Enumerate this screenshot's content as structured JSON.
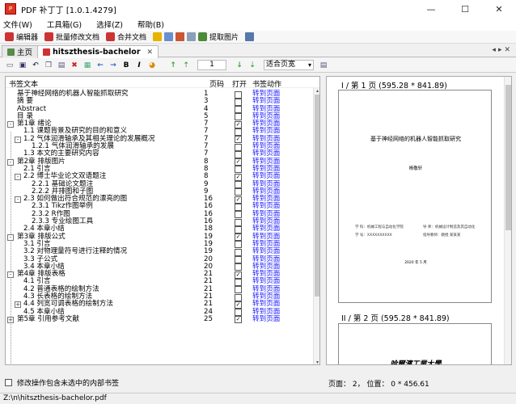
{
  "app": {
    "title": "PDF 补丁丁 [1.0.1.4279]"
  },
  "menu": [
    "文件(W)",
    "工具箱(G)",
    "选择(Z)",
    "帮助(B)"
  ],
  "toolbar1": [
    "编辑器",
    "批量修改文档",
    "合并文档",
    "提取图片"
  ],
  "tabs": {
    "home": "主页",
    "doc": "hitszthesis-bachelor"
  },
  "toolbar2": {
    "page": "1",
    "zoom": "适合页宽"
  },
  "table": {
    "headers": [
      "书签文本",
      "页码",
      "打开",
      "书签动作"
    ],
    "rows": [
      {
        "text": "基于神经网络的机器人智能抓取研究",
        "page": "1",
        "open": false,
        "action": "转到页面",
        "level": 0,
        "tog": ""
      },
      {
        "text": "摘  要",
        "page": "3",
        "open": false,
        "action": "转到页面",
        "level": 0,
        "tog": ""
      },
      {
        "text": "Abstract",
        "page": "4",
        "open": false,
        "action": "转到页面",
        "level": 0,
        "tog": ""
      },
      {
        "text": "目  录",
        "page": "5",
        "open": false,
        "action": "转到页面",
        "level": 0,
        "tog": ""
      },
      {
        "text": "第1章 绪论",
        "page": "7",
        "open": true,
        "action": "转到页面",
        "level": 0,
        "tog": "-"
      },
      {
        "text": "1.1 课题背景及研究的目的和意义",
        "page": "7",
        "open": false,
        "action": "转到页面",
        "level": 1,
        "tog": ""
      },
      {
        "text": "1.2 气体润滑轴承及其相关理论的发展概况",
        "page": "7",
        "open": true,
        "action": "转到页面",
        "level": 1,
        "tog": "-"
      },
      {
        "text": "1.2.1 气体润滑轴承的发展",
        "page": "7",
        "open": false,
        "action": "转到页面",
        "level": 2,
        "tog": ""
      },
      {
        "text": "1.3 本文的主要研究内容",
        "page": "7",
        "open": false,
        "action": "转到页面",
        "level": 1,
        "tog": ""
      },
      {
        "text": "第2章 排版图片",
        "page": "8",
        "open": true,
        "action": "转到页面",
        "level": 0,
        "tog": "-"
      },
      {
        "text": "2.1 引言",
        "page": "8",
        "open": false,
        "action": "转到页面",
        "level": 1,
        "tog": ""
      },
      {
        "text": "2.2 博士毕业论文双语题注",
        "page": "8",
        "open": true,
        "action": "转到页面",
        "level": 1,
        "tog": "-"
      },
      {
        "text": "2.2.1 基础论文题注",
        "page": "9",
        "open": false,
        "action": "转到页面",
        "level": 2,
        "tog": ""
      },
      {
        "text": "2.2.2 并排图和子图",
        "page": "9",
        "open": false,
        "action": "转到页面",
        "level": 2,
        "tog": ""
      },
      {
        "text": "2.3 如何做出符合规范的漂亮的图",
        "page": "16",
        "open": true,
        "action": "转到页面",
        "level": 1,
        "tog": "-"
      },
      {
        "text": "2.3.1 Tikz作图举例",
        "page": "16",
        "open": false,
        "action": "转到页面",
        "level": 2,
        "tog": ""
      },
      {
        "text": "2.3.2 R作图",
        "page": "16",
        "open": false,
        "action": "转到页面",
        "level": 2,
        "tog": ""
      },
      {
        "text": "2.3.3 专业绘图工具",
        "page": "16",
        "open": false,
        "action": "转到页面",
        "level": 2,
        "tog": ""
      },
      {
        "text": "2.4 本章小结",
        "page": "18",
        "open": false,
        "action": "转到页面",
        "level": 1,
        "tog": ""
      },
      {
        "text": "第3章 排版公式",
        "page": "19",
        "open": true,
        "action": "转到页面",
        "level": 0,
        "tog": "-"
      },
      {
        "text": "3.1 引言",
        "page": "19",
        "open": false,
        "action": "转到页面",
        "level": 1,
        "tog": ""
      },
      {
        "text": "3.2 对物理量符号进行注释的情况",
        "page": "19",
        "open": false,
        "action": "转到页面",
        "level": 1,
        "tog": ""
      },
      {
        "text": "3.3 子公式",
        "page": "20",
        "open": false,
        "action": "转到页面",
        "level": 1,
        "tog": ""
      },
      {
        "text": "3.4 本章小结",
        "page": "20",
        "open": false,
        "action": "转到页面",
        "level": 1,
        "tog": ""
      },
      {
        "text": "第4章 排版表格",
        "page": "21",
        "open": true,
        "action": "转到页面",
        "level": 0,
        "tog": "-"
      },
      {
        "text": "4.1 引言",
        "page": "21",
        "open": false,
        "action": "转到页面",
        "level": 1,
        "tog": ""
      },
      {
        "text": "4.2 普通表格的绘制方法",
        "page": "21",
        "open": false,
        "action": "转到页面",
        "level": 1,
        "tog": ""
      },
      {
        "text": "4.3 长表格的绘制方法",
        "page": "21",
        "open": false,
        "action": "转到页面",
        "level": 1,
        "tog": ""
      },
      {
        "text": "4.4 列宽可调表格的绘制方法",
        "page": "21",
        "open": true,
        "action": "转到页面",
        "level": 1,
        "tog": "+"
      },
      {
        "text": "4.5 本章小结",
        "page": "24",
        "open": false,
        "action": "转到页面",
        "level": 1,
        "tog": ""
      },
      {
        "text": "第5章 引用参考文献",
        "page": "25",
        "open": true,
        "action": "转到页面",
        "level": 0,
        "tog": "+"
      }
    ]
  },
  "bottom_check": "修改操作包含未选中的内部书签",
  "preview": {
    "page1_header": "I / 第 1 页 (595.28 * 841.89)",
    "page1_title": "基于神经网络的机器人智能抓取研究",
    "page1_author": "杨敬轩",
    "page1_info1": "学  科：机械工程与自动化学院",
    "page1_info2": "导  师：机械设计制造及其自动化",
    "page1_info3": "学  号：XXXXXXXXXX",
    "page1_info4": "指导教师：教授 某某某",
    "page1_date": "2020 年 5 月",
    "page2_header": "II / 第 2 页 (595.28 * 841.89)",
    "page2_title": "哈爾濱工業大學"
  },
  "page_status": "页面： 2， 位置： 0 * 456.61",
  "status_path": "Z:\\n\\hitszthesis-bachelor.pdf"
}
